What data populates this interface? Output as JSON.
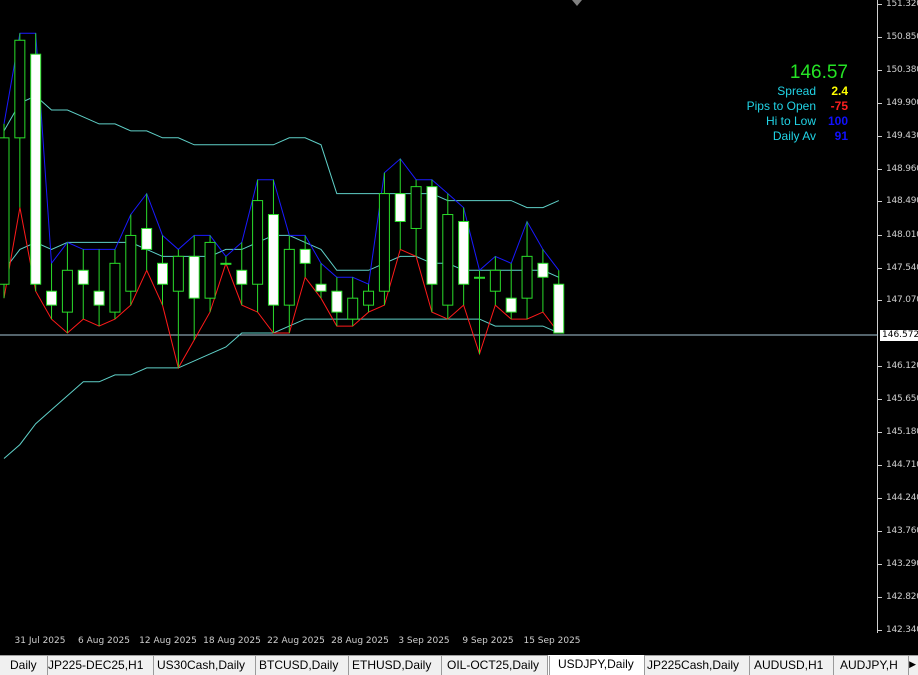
{
  "symbol": "USDJPY",
  "timeframe": "Daily",
  "info_panel": {
    "price": "146.57",
    "spread_label": "Spread",
    "spread_value": "2.4",
    "spread_color": "#ffff00",
    "pips_label": "Pips to Open",
    "pips_value": "-75",
    "pips_color": "#ff2020",
    "hilo_label": "Hi to Low",
    "hilo_value": "100",
    "hilo_color": "#1010ff",
    "dailyav_label": "Daily Av",
    "dailyav_value": "91",
    "dailyav_color": "#1010ff"
  },
  "price_axis": [
    "151.320",
    "150.850",
    "150.380",
    "149.900",
    "149.430",
    "148.960",
    "148.490",
    "148.010",
    "147.540",
    "147.070",
    "146.120",
    "145.650",
    "145.180",
    "144.710",
    "144.240",
    "143.760",
    "143.290",
    "142.820",
    "142.340"
  ],
  "current_price": "146.572",
  "date_axis": [
    "31 Jul 2025",
    "6 Aug 2025",
    "12 Aug 2025",
    "18 Aug 2025",
    "22 Aug 2025",
    "28 Aug 2025",
    "3 Sep 2025",
    "9 Sep 2025",
    "15 Sep 2025"
  ],
  "tabs": [
    {
      "label": "Daily",
      "active": false
    },
    {
      "label": "JP225-DEC25,H1",
      "active": false
    },
    {
      "label": "US30Cash,Daily",
      "active": false
    },
    {
      "label": "BTCUSD,Daily",
      "active": false
    },
    {
      "label": "ETHUSD,Daily",
      "active": false
    },
    {
      "label": "OIL-OCT25,Daily",
      "active": false
    },
    {
      "label": "USDJPY,Daily",
      "active": true
    },
    {
      "label": "JP225Cash,Daily",
      "active": false
    },
    {
      "label": "AUDUSD,H1",
      "active": false
    },
    {
      "label": "AUDJPY,H",
      "active": false
    }
  ],
  "colors": {
    "bull_candle": "#000000",
    "bear_candle": "#ffffff",
    "candle_wick": "#2adc2a",
    "channel_high": "#1a1aff",
    "channel_low": "#ff1a1a",
    "band": "#5fd0c8",
    "price_line": "#a8c8d8"
  },
  "chart_data": {
    "type": "candlestick",
    "y_range": [
      142.34,
      151.32
    ],
    "candles": [
      {
        "o": 147.3,
        "h": 149.6,
        "l": 147.1,
        "c": 149.4
      },
      {
        "o": 149.4,
        "h": 150.9,
        "l": 148.4,
        "c": 150.8
      },
      {
        "o": 150.6,
        "h": 150.9,
        "l": 147.2,
        "c": 147.3
      },
      {
        "o": 147.2,
        "h": 147.6,
        "l": 146.8,
        "c": 147.0
      },
      {
        "o": 146.9,
        "h": 147.9,
        "l": 146.6,
        "c": 147.5
      },
      {
        "o": 147.5,
        "h": 147.8,
        "l": 146.8,
        "c": 147.3
      },
      {
        "o": 147.2,
        "h": 147.8,
        "l": 146.7,
        "c": 147.0
      },
      {
        "o": 146.9,
        "h": 147.8,
        "l": 146.8,
        "c": 147.6
      },
      {
        "o": 147.2,
        "h": 148.3,
        "l": 147.0,
        "c": 148.0
      },
      {
        "o": 148.1,
        "h": 148.6,
        "l": 147.5,
        "c": 147.8
      },
      {
        "o": 147.6,
        "h": 148.0,
        "l": 147.0,
        "c": 147.3
      },
      {
        "o": 147.2,
        "h": 147.8,
        "l": 146.1,
        "c": 147.7
      },
      {
        "o": 147.7,
        "h": 148.0,
        "l": 146.5,
        "c": 147.1
      },
      {
        "o": 147.1,
        "h": 148.0,
        "l": 146.9,
        "c": 147.9
      },
      {
        "o": 147.6,
        "h": 147.7,
        "l": 147.6,
        "c": 147.6
      },
      {
        "o": 147.5,
        "h": 147.9,
        "l": 147.0,
        "c": 147.3
      },
      {
        "o": 147.3,
        "h": 148.8,
        "l": 146.9,
        "c": 148.5
      },
      {
        "o": 148.3,
        "h": 148.8,
        "l": 146.6,
        "c": 147.0
      },
      {
        "o": 147.0,
        "h": 148.0,
        "l": 146.6,
        "c": 147.8
      },
      {
        "o": 147.8,
        "h": 148.0,
        "l": 147.4,
        "c": 147.6
      },
      {
        "o": 147.3,
        "h": 147.6,
        "l": 147.1,
        "c": 147.2
      },
      {
        "o": 147.2,
        "h": 147.4,
        "l": 146.7,
        "c": 146.9
      },
      {
        "o": 146.8,
        "h": 147.4,
        "l": 146.7,
        "c": 147.1
      },
      {
        "o": 147.0,
        "h": 147.3,
        "l": 146.9,
        "c": 147.2
      },
      {
        "o": 147.2,
        "h": 148.9,
        "l": 147.0,
        "c": 148.6
      },
      {
        "o": 148.6,
        "h": 149.1,
        "l": 147.8,
        "c": 148.2
      },
      {
        "o": 148.1,
        "h": 148.8,
        "l": 147.7,
        "c": 148.7
      },
      {
        "o": 148.7,
        "h": 148.8,
        "l": 146.9,
        "c": 147.3
      },
      {
        "o": 147.0,
        "h": 148.6,
        "l": 146.8,
        "c": 148.3
      },
      {
        "o": 148.2,
        "h": 148.4,
        "l": 147.0,
        "c": 147.3
      },
      {
        "o": 147.4,
        "h": 147.5,
        "l": 146.3,
        "c": 147.4
      },
      {
        "o": 147.2,
        "h": 147.7,
        "l": 147.0,
        "c": 147.5
      },
      {
        "o": 147.1,
        "h": 147.6,
        "l": 146.8,
        "c": 146.9
      },
      {
        "o": 147.1,
        "h": 148.2,
        "l": 146.8,
        "c": 147.7
      },
      {
        "o": 147.6,
        "h": 147.8,
        "l": 146.9,
        "c": 147.4
      },
      {
        "o": 147.3,
        "h": 147.5,
        "l": 146.6,
        "c": 146.6
      }
    ],
    "band_upper": [
      149.5,
      149.9,
      150.0,
      149.8,
      149.8,
      149.7,
      149.6,
      149.6,
      149.5,
      149.5,
      149.4,
      149.4,
      149.3,
      149.3,
      149.3,
      149.3,
      149.3,
      149.3,
      149.4,
      149.4,
      149.3,
      148.6,
      148.6,
      148.6,
      148.6,
      148.6,
      148.6,
      148.6,
      148.5,
      148.5,
      148.5,
      148.5,
      148.5,
      148.4,
      148.4,
      148.5
    ],
    "band_mid": [
      147.5,
      147.8,
      147.9,
      147.8,
      147.9,
      147.9,
      147.9,
      147.9,
      147.9,
      147.8,
      147.7,
      147.7,
      147.7,
      147.7,
      147.8,
      147.8,
      147.9,
      148.0,
      148.0,
      147.9,
      147.8,
      147.5,
      147.5,
      147.5,
      147.6,
      147.7,
      147.7,
      147.6,
      147.6,
      147.5,
      147.5,
      147.5,
      147.5,
      147.5,
      147.5,
      147.4
    ],
    "band_lower": [
      144.8,
      145.0,
      145.3,
      145.5,
      145.7,
      145.9,
      145.9,
      146.0,
      146.0,
      146.1,
      146.1,
      146.1,
      146.2,
      146.3,
      146.4,
      146.6,
      146.6,
      146.6,
      146.7,
      146.8,
      146.8,
      146.8,
      146.8,
      146.8,
      146.8,
      146.8,
      146.8,
      146.8,
      146.8,
      146.8,
      146.8,
      146.7,
      146.7,
      146.7,
      146.7,
      146.6
    ]
  }
}
